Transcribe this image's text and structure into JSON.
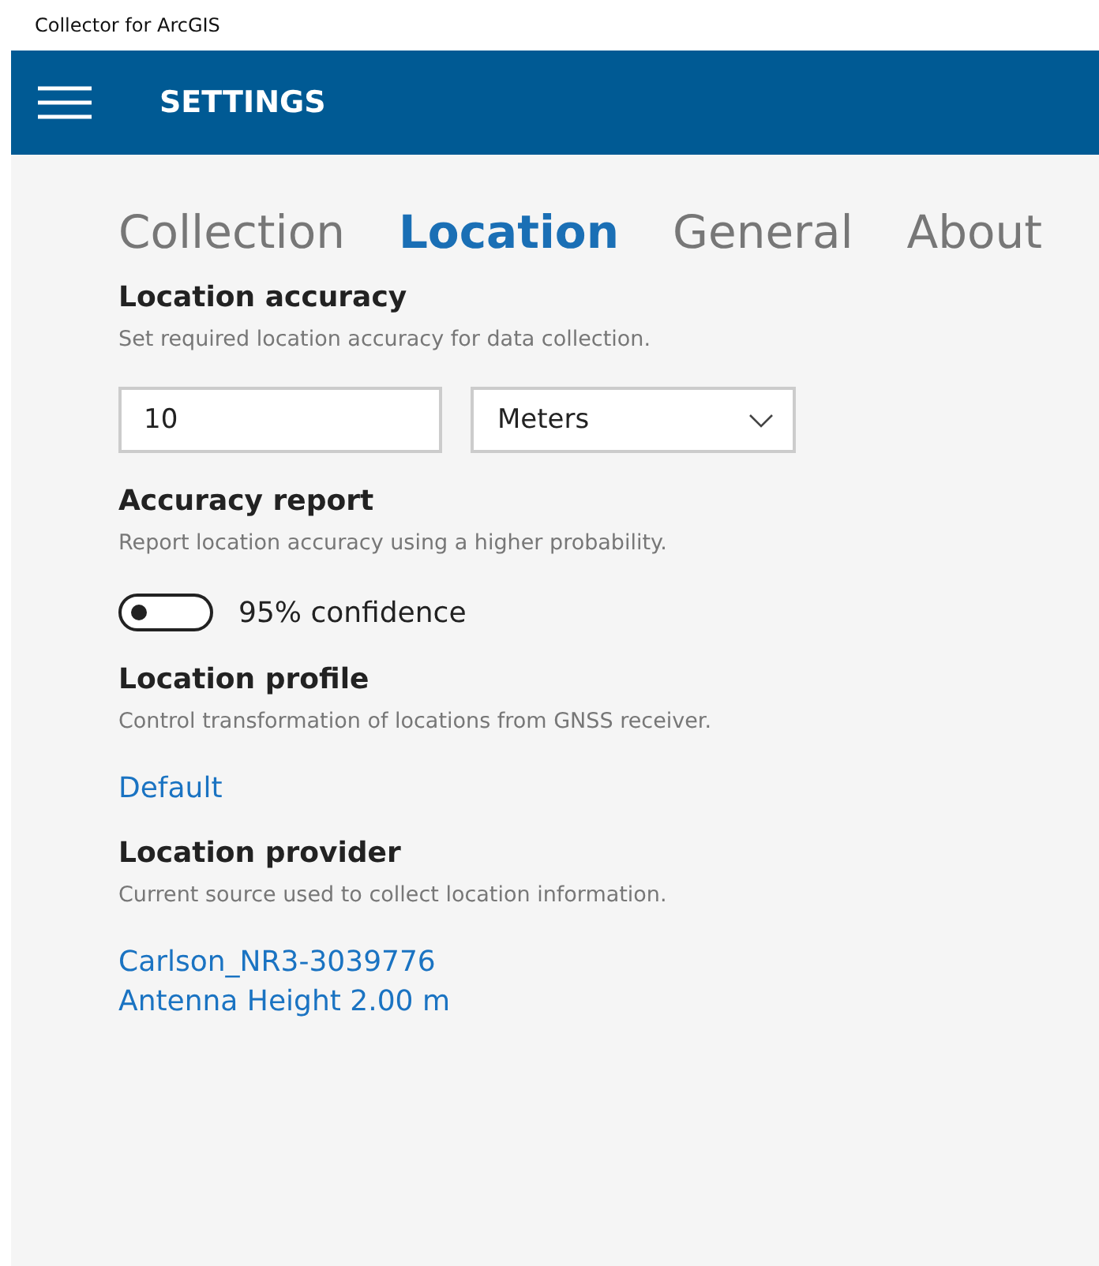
{
  "window": {
    "title": "Collector for ArcGIS"
  },
  "header": {
    "title": "SETTINGS"
  },
  "tabs": [
    {
      "label": "Collection",
      "selected": false
    },
    {
      "label": "Location",
      "selected": true
    },
    {
      "label": "General",
      "selected": false
    },
    {
      "label": "About",
      "selected": false
    }
  ],
  "sections": [
    {
      "kind": "fields",
      "heading": "Location accuracy",
      "description": "Set required location accuracy for data collection.",
      "value": "10",
      "unit": "Meters"
    },
    {
      "kind": "toggle",
      "heading": "Accuracy report",
      "description": "Report location accuracy using a higher probability.",
      "toggle": {
        "on": false,
        "label": "95% confidence"
      }
    },
    {
      "kind": "links",
      "heading": "Location profile",
      "description": "Control transformation of locations from GNSS receiver.",
      "links": [
        "Default"
      ]
    },
    {
      "kind": "links",
      "heading": "Location provider",
      "description": "Current source used to collect location information.",
      "links": [
        "Carlson_NR3-3039776",
        "Antenna Height 2.00 m"
      ]
    }
  ]
}
